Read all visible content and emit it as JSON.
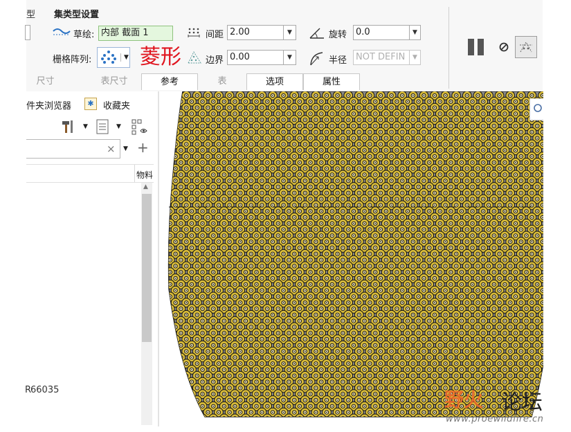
{
  "ribbon": {
    "partial_label": "型",
    "section_title": "集类型设置",
    "sketch_label": "草绘:",
    "sketch_value": "内部 截面 1",
    "pattern_label": "栅格阵列:",
    "pattern_annotation": "菱形",
    "spacing_label": "间距",
    "spacing_value": "2.00",
    "boundary_label": "边界",
    "boundary_value": "0.00",
    "rotation_label": "旋转",
    "rotation_value": "0.0",
    "radius_label": "半径",
    "radius_value": "NOT DEFIN",
    "tabs": [
      {
        "label": "尺寸",
        "state": "dim"
      },
      {
        "label": "表尺寸",
        "state": "dim"
      },
      {
        "label": "参考",
        "state": "normal"
      },
      {
        "label": "表",
        "state": "dim"
      },
      {
        "label": "选项",
        "state": "normal"
      },
      {
        "label": "属性",
        "state": "normal"
      }
    ]
  },
  "panel": {
    "tab_folder": "件夹浏览器",
    "tab_favorites": "收藏夹",
    "column_header": "物料",
    "item_id": "66035",
    "item_prefix": "R"
  },
  "watermark": {
    "brand": "野火",
    "forum": "论坛",
    "url": "www.proewildfire.cn"
  },
  "colors": {
    "accent_red": "#e0141e",
    "dot_fill": "#d8bb3a",
    "canvas_fill": "#8e8e8e",
    "wm_orange": "#f26a2a"
  }
}
